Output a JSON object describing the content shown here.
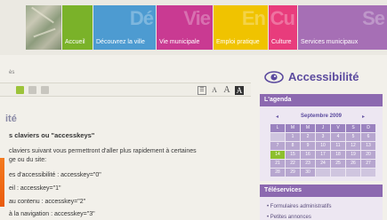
{
  "nav": {
    "tabs": [
      {
        "label": "Accueil",
        "big": "",
        "color": "#7ab229"
      },
      {
        "label": "Découvrez la ville",
        "big": "Dé",
        "color": "#4d9bd1"
      },
      {
        "label": "Vie municipale",
        "big": "Vie",
        "color": "#c93a92"
      },
      {
        "label": "Emploi pratique",
        "big": "En",
        "color": "#f0c300"
      },
      {
        "label": "Culture",
        "big": "Cu",
        "color": "#e83c7c"
      },
      {
        "label": "Services municipaux",
        "big": "Se",
        "color": "#a66fb5"
      }
    ]
  },
  "breadcrumb": "ès",
  "toolbar": {
    "print": "☰",
    "font_small": "A",
    "font_big": "A",
    "contrast": "A"
  },
  "main": {
    "title": "ité",
    "heading": "s claviers ou \"accesskeys\"",
    "paragraph": [
      "claviers suivant vous permettront d'aller plus rapidement à certaines",
      "ge ou du site:"
    ],
    "accesskeys": [
      "es d'accessibilité : accesskey=\"0\"",
      "eil : accesskey=\"1\"",
      "au contenu : accesskey=\"2\"",
      "à la navigation : accesskey=\"3\""
    ]
  },
  "sidebar": {
    "accessibility_title": "Accessibilité",
    "agenda": {
      "title": "L'agenda",
      "prev": "◂",
      "next": "▸",
      "month": "Septembre 2009",
      "day_headers": [
        "L",
        "M",
        "M",
        "J",
        "V",
        "S",
        "D"
      ],
      "days": [
        [
          "",
          "1",
          "2",
          "3",
          "4",
          "5",
          "6"
        ],
        [
          "7",
          "8",
          "9",
          "10",
          "11",
          "12",
          "13"
        ],
        [
          "14",
          "15",
          "16",
          "17",
          "18",
          "19",
          "20"
        ],
        [
          "21",
          "22",
          "23",
          "24",
          "25",
          "26",
          "27"
        ],
        [
          "28",
          "29",
          "30",
          "",
          "",
          "",
          ""
        ]
      ]
    },
    "teleservices": {
      "title": "Téléservices",
      "items": [
        "Formulaires administratifs",
        "Petites annonces"
      ]
    }
  }
}
